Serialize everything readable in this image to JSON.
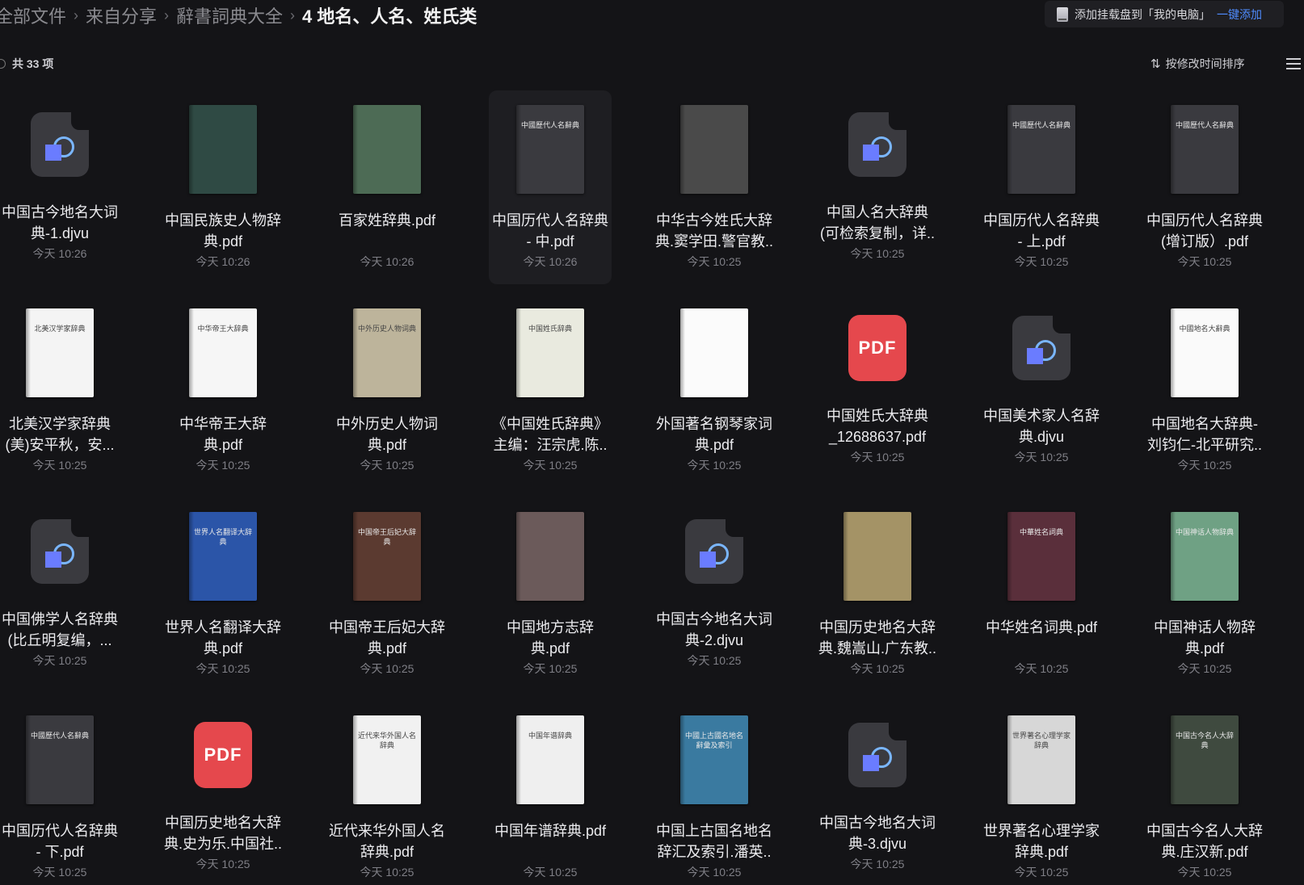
{
  "breadcrumb": [
    "全部文件",
    "来自分享",
    "辭書詞典大全",
    "4 地名、人名、姓氏类"
  ],
  "mount": {
    "text": "添加挂载盘到「我的电脑」",
    "link": "一键添加"
  },
  "count": "共 33 项",
  "sort": {
    "label": "按修改时间排序"
  },
  "files": [
    {
      "name": "中国古今地名大词典-1.djvu",
      "time": "今天 10:26",
      "icon": "djvu"
    },
    {
      "name": "中国民族史人物辞典.pdf",
      "time": "今天 10:26",
      "icon": "book",
      "color": "#2f4a44"
    },
    {
      "name": "百家姓辞典.pdf",
      "time": "今天 10:26",
      "icon": "book",
      "color": "#4d6b55"
    },
    {
      "name": "中国历代人名辞典 - 中.pdf",
      "time": "今天 10:26",
      "icon": "book",
      "color": "#3a3a3f",
      "cover": "中國歷代人名辭典"
    },
    {
      "name": "中华古今姓氏大辞典.窦学田.警官教..",
      "time": "今天 10:25",
      "icon": "book",
      "color": "#4a4a4a"
    },
    {
      "name": "中国人名大辞典(可检索复制，详..",
      "time": "今天 10:25",
      "icon": "djvu"
    },
    {
      "name": "中国历代人名辞典 - 上.pdf",
      "time": "今天 10:25",
      "icon": "book",
      "color": "#3a3a3f",
      "cover": "中國歷代人名辭典"
    },
    {
      "name": "中国历代人名辞典(增订版）.pdf",
      "time": "今天 10:25",
      "icon": "book",
      "color": "#3a3a3f",
      "cover": "中國歷代人名辭典"
    },
    {
      "name": "北美汉学家辞典(美)安平秋，安...",
      "time": "今天 10:25",
      "icon": "book",
      "color": "#f4f4f4",
      "cover": "北美汉学家辞典"
    },
    {
      "name": "中华帝王大辞典.pdf",
      "time": "今天 10:25",
      "icon": "book",
      "color": "#f6f6f6",
      "cover": "中华帝王大辞典"
    },
    {
      "name": "中外历史人物词典.pdf",
      "time": "今天 10:25",
      "icon": "book",
      "color": "#bdb49b",
      "cover": "中外历史人物词典"
    },
    {
      "name": "《中国姓氏辞典》主编：汪宗虎.陈..",
      "time": "今天 10:25",
      "icon": "book",
      "color": "#e9eadf",
      "cover": "中国姓氏辞典"
    },
    {
      "name": "外国著名钢琴家词典.pdf",
      "time": "今天 10:25",
      "icon": "book",
      "color": "#fbfbfb"
    },
    {
      "name": "中国姓氏大辞典_12688637.pdf",
      "time": "今天 10:25",
      "icon": "pdf"
    },
    {
      "name": "中国美术家人名辞典.djvu",
      "time": "今天 10:25",
      "icon": "djvu"
    },
    {
      "name": "中国地名大辞典-刘钧仁-北平研究..",
      "time": "今天 10:25",
      "icon": "book",
      "color": "#fafafa",
      "cover": "中國地名大辭典"
    },
    {
      "name": "中国佛学人名辞典(比丘明复编，...",
      "time": "今天 10:25",
      "icon": "djvu"
    },
    {
      "name": "世界人名翻译大辞典.pdf",
      "time": "今天 10:25",
      "icon": "book",
      "color": "#2b55a8",
      "cover": "世界人名翻译大辞典"
    },
    {
      "name": "中国帝王后妃大辞典.pdf",
      "time": "今天 10:25",
      "icon": "book",
      "color": "#5b3a30",
      "cover": "中国帝王后妃大辞典"
    },
    {
      "name": "中国地方志辞典.pdf",
      "time": "今天 10:25",
      "icon": "book",
      "color": "#6b5a5a"
    },
    {
      "name": "中国古今地名大词典-2.djvu",
      "time": "今天 10:25",
      "icon": "djvu"
    },
    {
      "name": "中国历史地名大辞典.魏嵩山.广东教..",
      "time": "今天 10:25",
      "icon": "book",
      "color": "#a49366"
    },
    {
      "name": "中华姓名词典.pdf",
      "time": "今天 10:25",
      "icon": "book",
      "color": "#5a2f3b",
      "cover": "中華姓名詞典"
    },
    {
      "name": "中国神话人物辞典.pdf",
      "time": "今天 10:25",
      "icon": "book",
      "color": "#6fa184",
      "cover": "中国神话人物辞典"
    },
    {
      "name": "中国历代人名辞典 - 下.pdf",
      "time": "今天 10:25",
      "icon": "book",
      "color": "#3a3a3f",
      "cover": "中國歷代人名辭典"
    },
    {
      "name": "中国历史地名大辞典.史为乐.中国社..",
      "time": "今天 10:25",
      "icon": "pdf"
    },
    {
      "name": "近代来华外国人名辞典.pdf",
      "time": "今天 10:25",
      "icon": "book",
      "color": "#f1f1f1",
      "cover": "近代来华外国人名辞典"
    },
    {
      "name": "中国年谱辞典.pdf",
      "time": "今天 10:25",
      "icon": "book",
      "color": "#efefef",
      "cover": "中国年谱辞典"
    },
    {
      "name": "中国上古国名地名辞汇及索引.潘英..",
      "time": "今天 10:25",
      "icon": "book",
      "color": "#3a7aa0",
      "cover": "中國上古國名地名辭彙及索引"
    },
    {
      "name": "中国古今地名大词典-3.djvu",
      "time": "今天 10:25",
      "icon": "djvu"
    },
    {
      "name": "世界著名心理学家辞典.pdf",
      "time": "今天 10:25",
      "icon": "book",
      "color": "#d7d7d7",
      "cover": "世界著名心理学家辞典"
    },
    {
      "name": "中国古今名人大辞典.庄汉新.pdf",
      "time": "今天 10:25",
      "icon": "book",
      "color": "#3f4a3f",
      "cover": "中国古今名人大辞典"
    }
  ]
}
